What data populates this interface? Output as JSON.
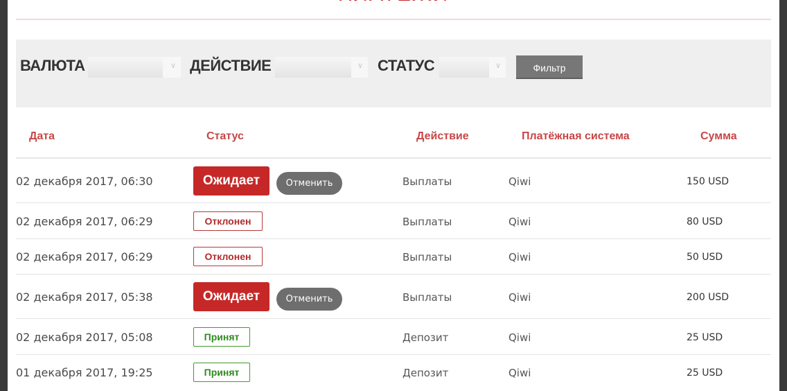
{
  "page": {
    "title": "ПЛАТЕЖИ"
  },
  "filters": {
    "currency_label": "ВАЛЮТА",
    "currency_value": "",
    "action_label": "ДЕЙСТВИЕ",
    "action_value": "",
    "status_label": "СТАТУС",
    "status_value": "",
    "filter_button": "Фильтр"
  },
  "table": {
    "columns": [
      "Дата",
      "Статус",
      "Действие",
      "Платёжная система",
      "Сумма"
    ],
    "rows": [
      {
        "date": "02 декабря 2017, 06:30",
        "status": "Ожидает",
        "status_kind": "pending",
        "cancel_label": "Отменить",
        "action": "Выплаты",
        "system": "Qiwi",
        "amount": "150 USD"
      },
      {
        "date": "02 декабря 2017, 06:29",
        "status": "Отклонен",
        "status_kind": "rejected",
        "action": "Выплаты",
        "system": "Qiwi",
        "amount": "80 USD"
      },
      {
        "date": "02 декабря 2017, 06:29",
        "status": "Отклонен",
        "status_kind": "rejected",
        "action": "Выплаты",
        "system": "Qiwi",
        "amount": "50 USD"
      },
      {
        "date": "02 декабря 2017, 05:38",
        "status": "Ожидает",
        "status_kind": "pending",
        "cancel_label": "Отменить",
        "action": "Выплаты",
        "system": "Qiwi",
        "amount": "200 USD"
      },
      {
        "date": "02 декабря 2017, 05:08",
        "status": "Принят",
        "status_kind": "accepted",
        "action": "Депозит",
        "system": "Qiwi",
        "amount": "25 USD"
      },
      {
        "date": "01 декабря 2017, 19:25",
        "status": "Принят",
        "status_kind": "accepted",
        "action": "Депозит",
        "system": "Qiwi",
        "amount": "25 USD"
      }
    ]
  },
  "colors": {
    "accent_red": "#c62828",
    "header_red": "#c84646",
    "accepted_green": "#3f9c2b",
    "rejected_red": "#b53a3a",
    "filter_bar_bg": "#efefef",
    "button_gray": "#777777"
  }
}
